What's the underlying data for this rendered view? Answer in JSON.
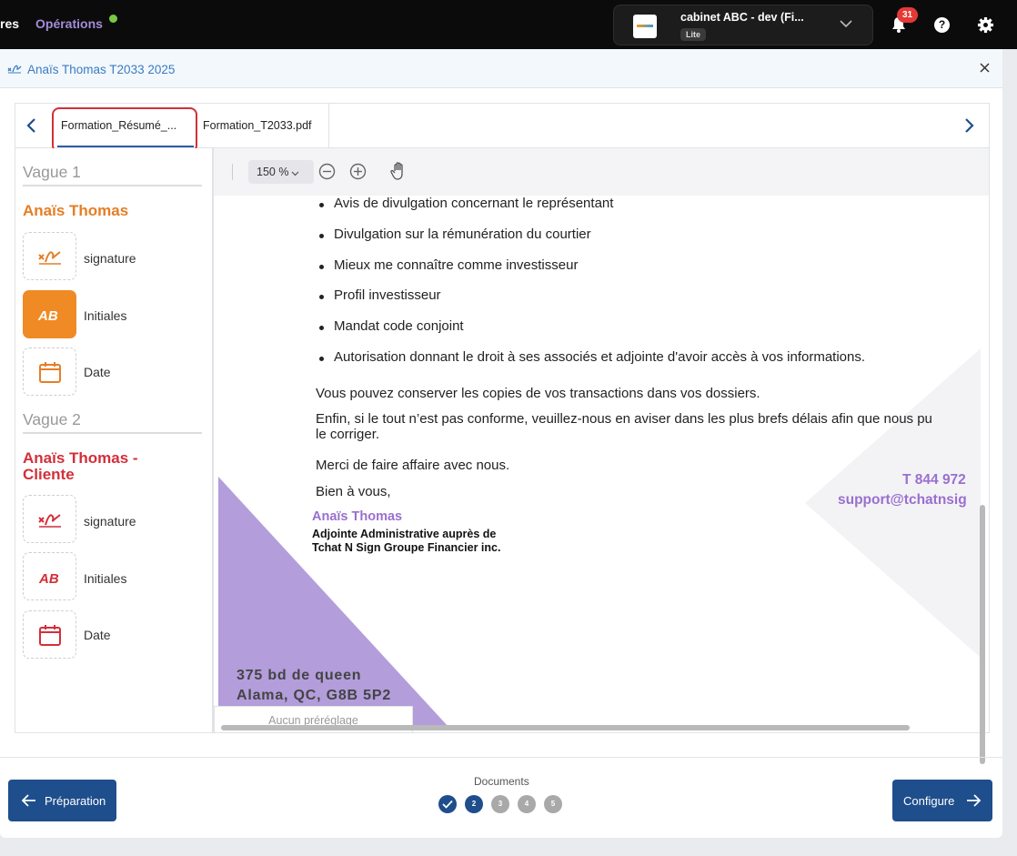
{
  "topbar": {
    "nav_left": "res",
    "nav_operations": "Opérations",
    "account_name": "cabinet ABC - dev (Fi...",
    "account_plan": "Lite",
    "notification_count": "31",
    "help_label": "?"
  },
  "modal": {
    "title": "Anaïs Thomas T2033 2025"
  },
  "tabs": [
    {
      "label": "Formation_Résumé_...",
      "active": true
    },
    {
      "label": "Formation_T2033.pdf",
      "active": false
    }
  ],
  "fields_panel": {
    "wave1": "Vague 1",
    "signer1": "Anaïs Thomas",
    "signer1_fields": [
      "signature",
      "Initiales",
      "Date"
    ],
    "wave2": "Vague 2",
    "signer2_line1": "Anaïs Thomas -",
    "signer2_line2": "Cliente",
    "signer2_fields": [
      "signature",
      "Initiales",
      "Date"
    ]
  },
  "viewer": {
    "zoom": "150 %",
    "preset": "Aucun préréglage"
  },
  "document": {
    "bullets": [
      "Avis de divulgation concernant le représentant",
      "Divulgation sur la rémunération du courtier",
      "Mieux me connaître comme investisseur",
      "Profil investisseur",
      "Mandat code conjoint",
      "Autorisation donnant le droit à ses associés et adjointe d'avoir accès à vos informations."
    ],
    "para1": "Vous pouvez conserver les copies de vos transactions dans vos dossiers.",
    "para2_line1": "Enfin, si le tout n’est pas conforme, veuillez-nous en aviser dans les plus brefs délais afin que nous pu",
    "para2_line2": "le corriger.",
    "para3": "Merci de faire affaire avec nous.",
    "closing": "Bien à vous,",
    "signer_name": "Anaïs Thomas",
    "signer_role_line1": "Adjointe Administrative auprès de",
    "signer_role_line2": "Tchat N Sign Groupe Financier inc.",
    "phone": "T 844 972",
    "email": "support@tchatnsig",
    "address_line1": "375 bd de queen",
    "address_line2": "Alama, QC, G8B 5P2"
  },
  "footer": {
    "prev_label": "Préparation",
    "next_label": "Configure",
    "docs_label": "Documents",
    "steps": [
      "",
      "2",
      "3",
      "4",
      "5"
    ],
    "current_step": 2
  },
  "colors": {
    "accent_blue": "#1f4e8c",
    "signer1_orange": "#e57e25",
    "signer2_red": "#d32f3a",
    "brand_purple": "#9a6fcf"
  }
}
